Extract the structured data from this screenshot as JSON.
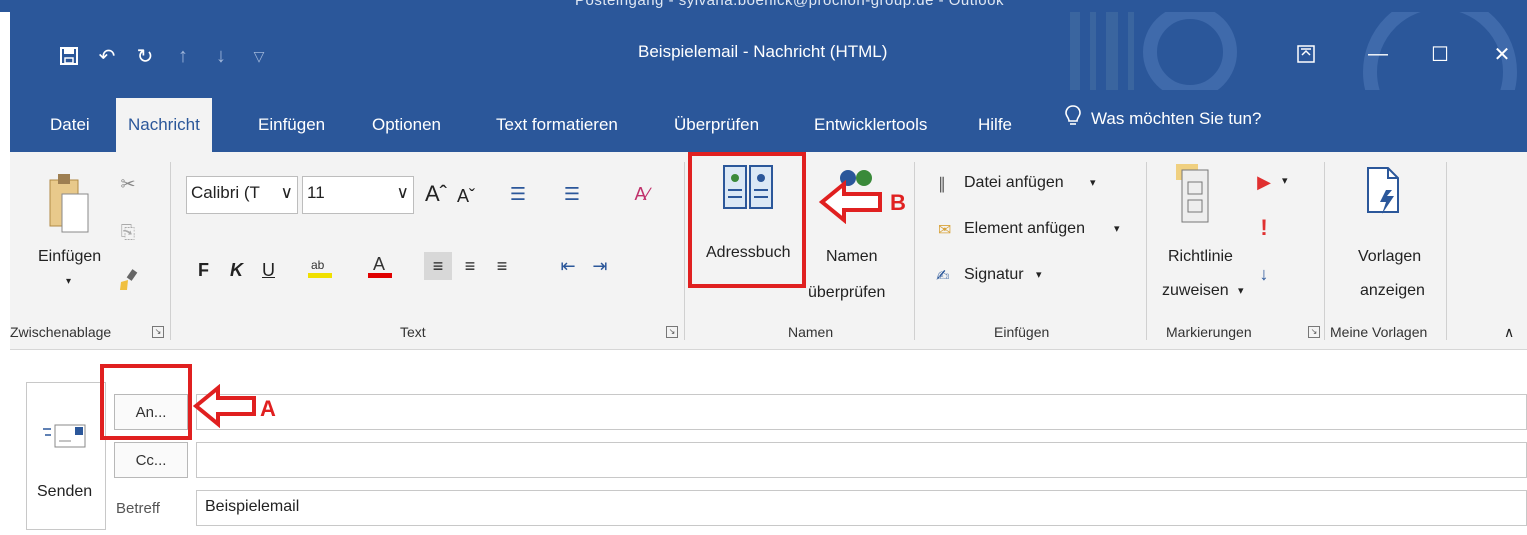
{
  "background_window_title": "Posteingang - sylvana.boenick@procilon-group.de - Outlook",
  "window": {
    "title": "Beispielemail  -  Nachricht (HTML)"
  },
  "qat": [
    "save-icon",
    "undo-icon",
    "redo-icon",
    "up-arrow-icon",
    "down-arrow-icon",
    "customize-dropdown-icon"
  ],
  "tabs": [
    {
      "label": "Datei",
      "active": false
    },
    {
      "label": "Nachricht",
      "active": true
    },
    {
      "label": "Einfügen",
      "active": false
    },
    {
      "label": "Optionen",
      "active": false
    },
    {
      "label": "Text formatieren",
      "active": false
    },
    {
      "label": "Überprüfen",
      "active": false
    },
    {
      "label": "Entwicklertools",
      "active": false
    },
    {
      "label": "Hilfe",
      "active": false
    }
  ],
  "tell_me": "Was möchten Sie tun?",
  "ribbon": {
    "clipboard": {
      "paste": "Einfügen",
      "group": "Zwischenablage"
    },
    "text": {
      "font": "Calibri (T",
      "size": "11",
      "bold": "F",
      "italic": "K",
      "underline": "U",
      "group": "Text"
    },
    "names": {
      "address_book": "Adressbuch",
      "check_names_1": "Namen",
      "check_names_2": "überprüfen",
      "group": "Namen"
    },
    "include": {
      "attach_file": "Datei anfügen",
      "attach_item": "Element anfügen",
      "signature": "Signatur",
      "group": "Einfügen"
    },
    "tags": {
      "assign_policy_1": "Richtlinie",
      "assign_policy_2": "zuweisen",
      "group": "Markierungen"
    },
    "templates": {
      "view_1": "Vorlagen",
      "view_2": "anzeigen",
      "group": "Meine Vorlagen"
    }
  },
  "compose": {
    "send": "Senden",
    "to_button": "An...",
    "cc_button": "Cc...",
    "subject_label": "Betreff",
    "to_value": "",
    "cc_value": "",
    "subject_value": "Beispielemail"
  },
  "annotations": {
    "a": "A",
    "b": "B"
  },
  "colors": {
    "accent": "#2b579a",
    "annotation": "#e02020"
  }
}
